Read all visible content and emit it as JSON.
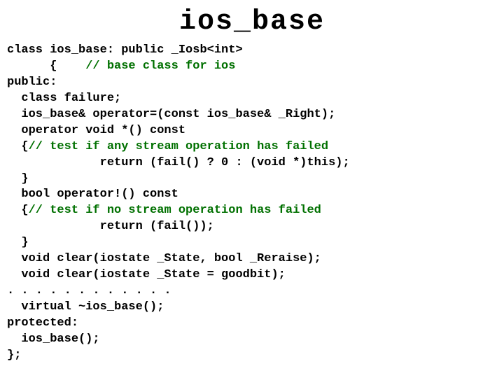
{
  "title": "ios_base",
  "code": {
    "l01a": "class ios_base: public _Iosb<int>",
    "l02a": "      {    ",
    "l02c": "// base class for ios",
    "l03": "public:",
    "l04": "  class failure;",
    "l05": "  ios_base& operator=(const ios_base& _Right);",
    "l06": "  operator void *() const",
    "l07a": "  {",
    "l07c": "// test if any stream operation has failed",
    "l08": "             return (fail() ? 0 : (void *)this);",
    "l09": "  }",
    "l10": "  bool operator!() const",
    "l11a": "  {",
    "l11c": "// test if no stream operation has failed",
    "l12": "             return (fail());",
    "l13": "  }",
    "l14": "  void clear(iostate _State, bool _Reraise);",
    "l15": "  void clear(iostate _State = goodbit);",
    "l16": ". . . . . . . . . . . .",
    "l17": "  virtual ~ios_base();",
    "l18": "protected:",
    "l19": "  ios_base();",
    "l20": "};"
  }
}
